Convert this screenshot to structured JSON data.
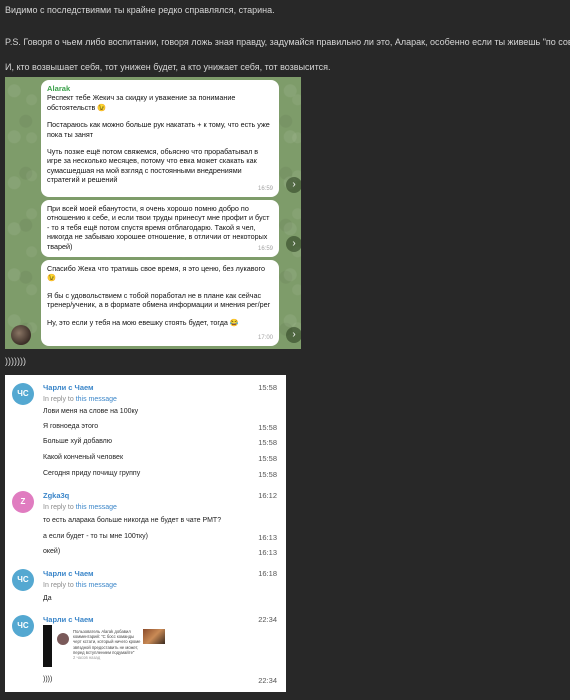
{
  "post": {
    "line1": "Видимо с последствиями ты крайне редко справлялся, старина.",
    "line2": "P.S. Говоря о чьем либо воспитании, говоря ложь зная правду, задумайся правильно ли это, Аларак, особенно если ты живешь \"по совести\"",
    "line3": "И, кто возвышает себя, тот унижен будет, а кто унижает себя, тот возвысится.",
    "line4": ")))))))"
  },
  "telegram": {
    "sender": "Alarak",
    "messages": [
      {
        "paragraphs": [
          "Респект тебе Жекич за скидку и уважение за понимание обстоятельств 😉",
          "Постараюсь как можно больше рук накатать + к тому, что есть уже пока ты занят",
          "Чуть позже ещё потом свяжемся, обьясню что прорабатывал в игре за несколько месяцев, потому что евка может скакать как сумасшедшая на мой взгляд с постоянными внедрениями стратегий и решений"
        ],
        "time": "16:59"
      },
      {
        "paragraphs": [
          "При всей моей ебанутости, я очень хорошо помню добро по отношению к себе, и если твои труды принесут мне профит и буст - то я тебя ещё потом спустя время отблагодарю. Такой я чел, никогда не забываю хорошее отношение, в отличии от некоторых тварей)"
        ],
        "time": "16:59"
      },
      {
        "paragraphs": [
          "Спасибо Жека что тратишь свое время, я это ценю, без лукавого 😉",
          "Я бы с удовольствием с тобой поработал не в плане как сейчас тренер/ученик, а в формате обмена информации и мнения рег/рег",
          "Ну, это если у тебя на мою евешку стоять будет, тогда 😂"
        ],
        "time": "17:00"
      }
    ],
    "forward_icon": "chevron-right-icon"
  },
  "chatlog": {
    "reply_prefix": "In reply to",
    "reply_link": "this message",
    "groups": [
      {
        "initials": "ЧС",
        "author": "Чарли с Чаем",
        "time": "15:58",
        "has_reply": true
      },
      {
        "initials": "Z",
        "author": "Zgka3q",
        "time": "16:12",
        "has_reply": true
      },
      {
        "initials": "ЧС",
        "author": "Чарли с Чаем",
        "time": "16:18",
        "has_reply": true
      },
      {
        "initials": "ЧС",
        "author": "Чарли с Чаем",
        "time": "22:34",
        "has_reply": false
      }
    ],
    "messages": [
      {
        "text": "Лови меня на слове на 100ку",
        "time": ""
      },
      {
        "text": "Я говноеда этого",
        "time": "15:58"
      },
      {
        "text": "Больше хуй добавлю",
        "time": "15:58"
      },
      {
        "text": "Какой конченый человек",
        "time": "15:58"
      },
      {
        "text": "Сегодня приду почищу группу",
        "time": "15:58"
      },
      {
        "text": "то есть аларака больше никогда не будет в чате РМТ?",
        "time": ""
      },
      {
        "text": "а если будет - то ты мне 100тку)",
        "time": "16:13"
      },
      {
        "text": "окей)",
        "time": "16:13"
      },
      {
        "text": "Да",
        "time": ""
      },
      {
        "text": "))))",
        "time": "22:34"
      }
    ],
    "thumb_text": "Пользователь Alarak добавил комментарий: \"С босс команды черт кстати, который ничего кроме звёздной предоставить не может, перед вступлением подумайте\"",
    "thumb_footer": "2 часов назад"
  },
  "colors": {
    "accent_blue": "#3b86c9",
    "sender_green": "#3aa14a",
    "avatar_blue": "#54a8d1",
    "avatar_pink": "#e07cc0"
  }
}
